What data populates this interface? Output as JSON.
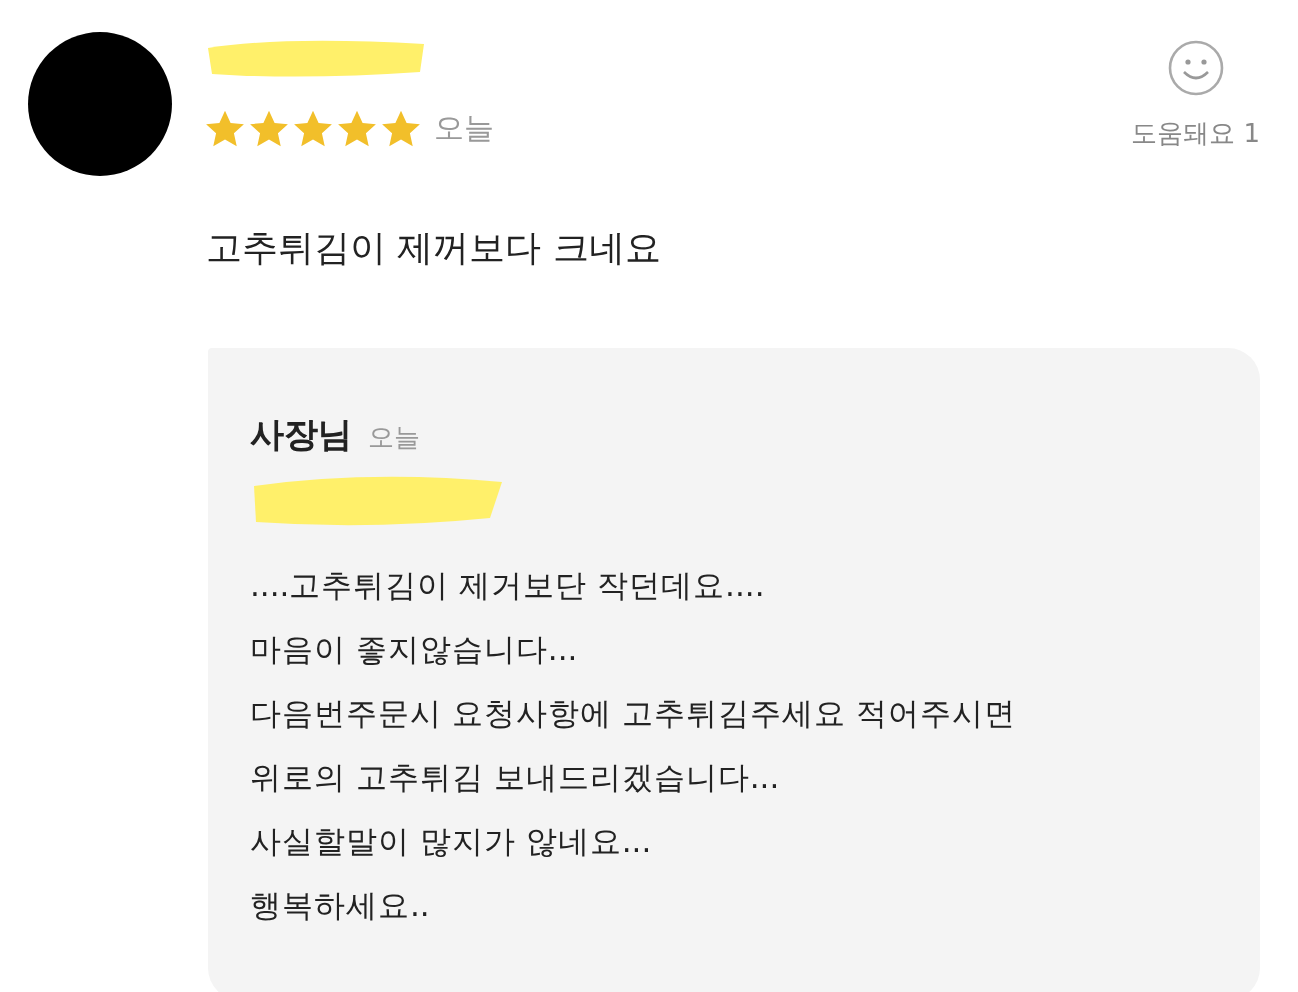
{
  "review": {
    "stars": 5,
    "date": "오늘",
    "helpful": "도움돼요 1",
    "text": "고추튀김이 제꺼보다 크네요"
  },
  "reply": {
    "author": "사장님",
    "date": "오늘",
    "lines": [
      "....고추튀김이 제거보단 작던데요....",
      "마음이 좋지않습니다...",
      "다음번주문시 요청사항에 고추튀김주세요 적어주시면",
      "위로의 고추튀김 보내드리겠습니다...",
      "사실할말이 많지가 않네요...",
      "행복하세요.."
    ]
  }
}
